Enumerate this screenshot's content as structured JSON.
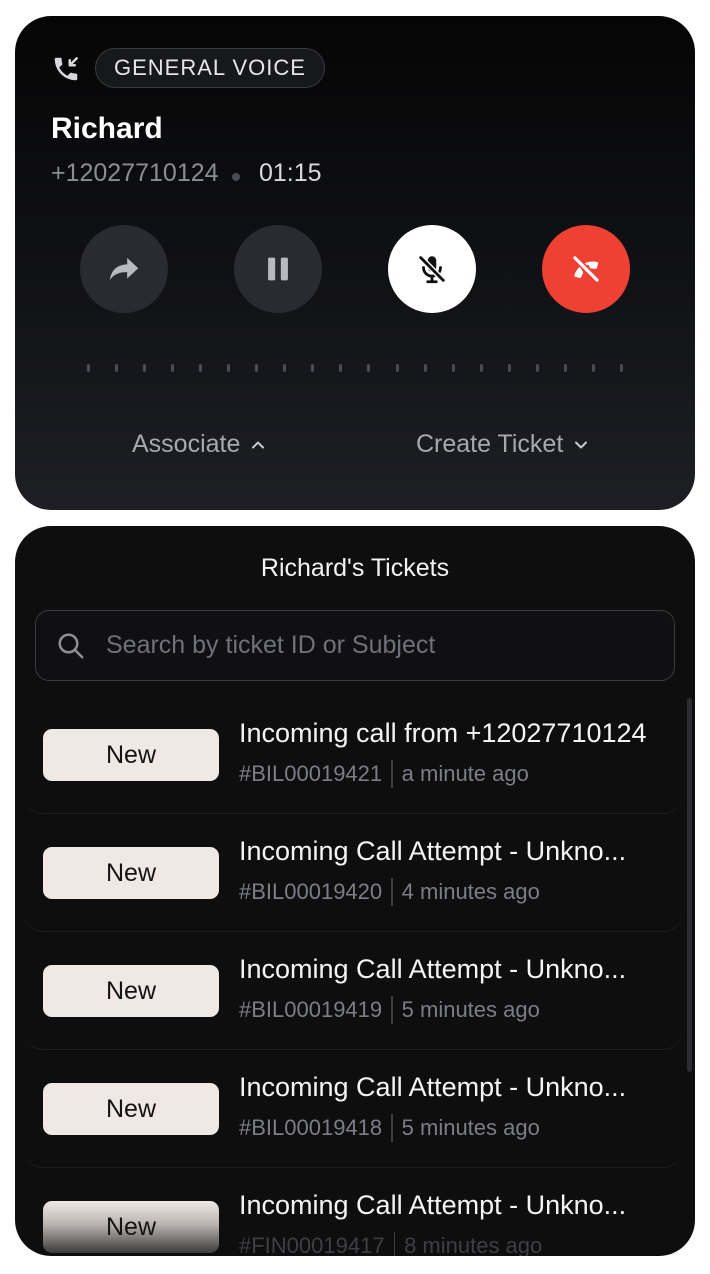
{
  "call": {
    "queue_label": "GENERAL VOICE",
    "caller_name": "Richard",
    "caller_phone": "+12027710124",
    "duration": "01:15",
    "associate_label": "Associate",
    "create_ticket_label": "Create Ticket",
    "colors": {
      "hangup": "#ee4134",
      "mute_active": "#ffffff",
      "button_bg": "#2a2b30"
    }
  },
  "tickets_panel": {
    "title": "Richard's Tickets",
    "search_placeholder": "Search by ticket ID or Subject",
    "tickets": [
      {
        "status": "New",
        "subject": "Incoming call from +12027710124",
        "id": "#BIL00019421",
        "time": "a minute ago"
      },
      {
        "status": "New",
        "subject": "Incoming Call Attempt - Unkno...",
        "id": "#BIL00019420",
        "time": "4 minutes ago"
      },
      {
        "status": "New",
        "subject": "Incoming Call Attempt - Unkno...",
        "id": "#BIL00019419",
        "time": "5 minutes ago"
      },
      {
        "status": "New",
        "subject": "Incoming Call Attempt - Unkno...",
        "id": "#BIL00019418",
        "time": "5 minutes ago"
      },
      {
        "status": "New",
        "subject": "Incoming Call Attempt - Unkno...",
        "id": "#FIN00019417",
        "time": "8 minutes ago"
      }
    ]
  }
}
